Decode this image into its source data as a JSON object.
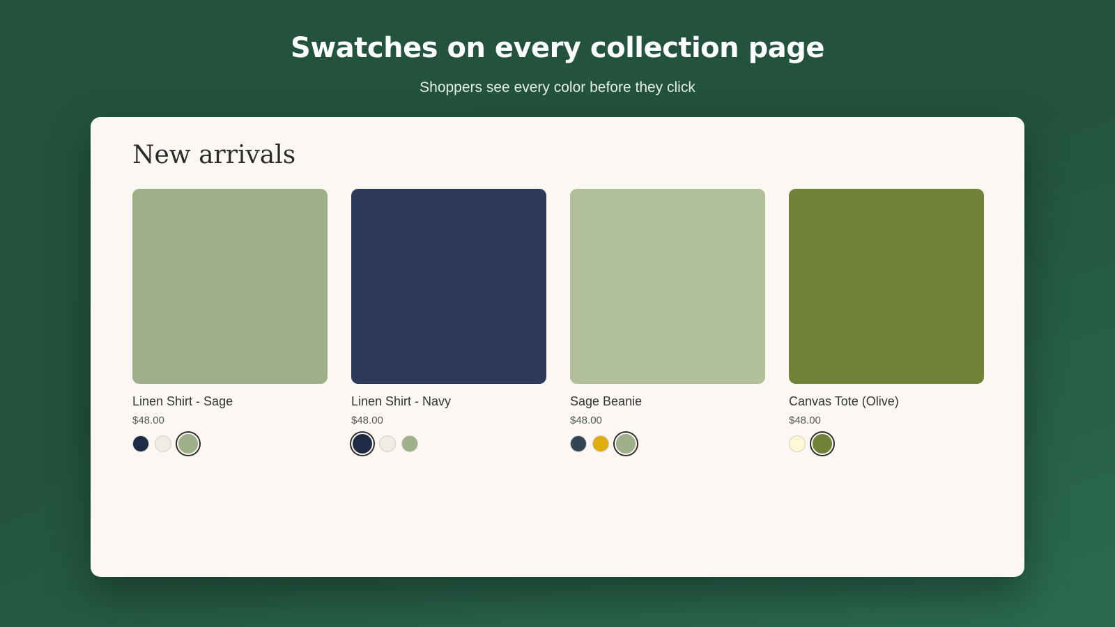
{
  "hero": {
    "title": "Swatches on every collection page",
    "subtitle": "Shoppers see every color before they click"
  },
  "section": {
    "title": "New arrivals"
  },
  "products": [
    {
      "name": "Linen Shirt - Sage",
      "price": "$48.00",
      "image_color": "#9db08a",
      "swatches": [
        {
          "color": "#1f2a44",
          "selected": false
        },
        {
          "color": "#efece4",
          "selected": false
        },
        {
          "color": "#9db08a",
          "selected": true
        }
      ]
    },
    {
      "name": "Linen Shirt - Navy",
      "price": "$48.00",
      "image_color": "#2d3a5b",
      "swatches": [
        {
          "color": "#1f2a44",
          "selected": true
        },
        {
          "color": "#efece4",
          "selected": false
        },
        {
          "color": "#9db08a",
          "selected": false
        }
      ]
    },
    {
      "name": "Sage Beanie",
      "price": "$48.00",
      "image_color": "#b1c09b",
      "swatches": [
        {
          "color": "#344454",
          "selected": false
        },
        {
          "color": "#e0ac10",
          "selected": false
        },
        {
          "color": "#9db08a",
          "selected": true
        }
      ]
    },
    {
      "name": "Canvas Tote (Olive)",
      "price": "$48.00",
      "image_color": "#708338",
      "swatches": [
        {
          "color": "#fff8d4",
          "selected": false
        },
        {
          "color": "#708338",
          "selected": true
        }
      ]
    }
  ]
}
